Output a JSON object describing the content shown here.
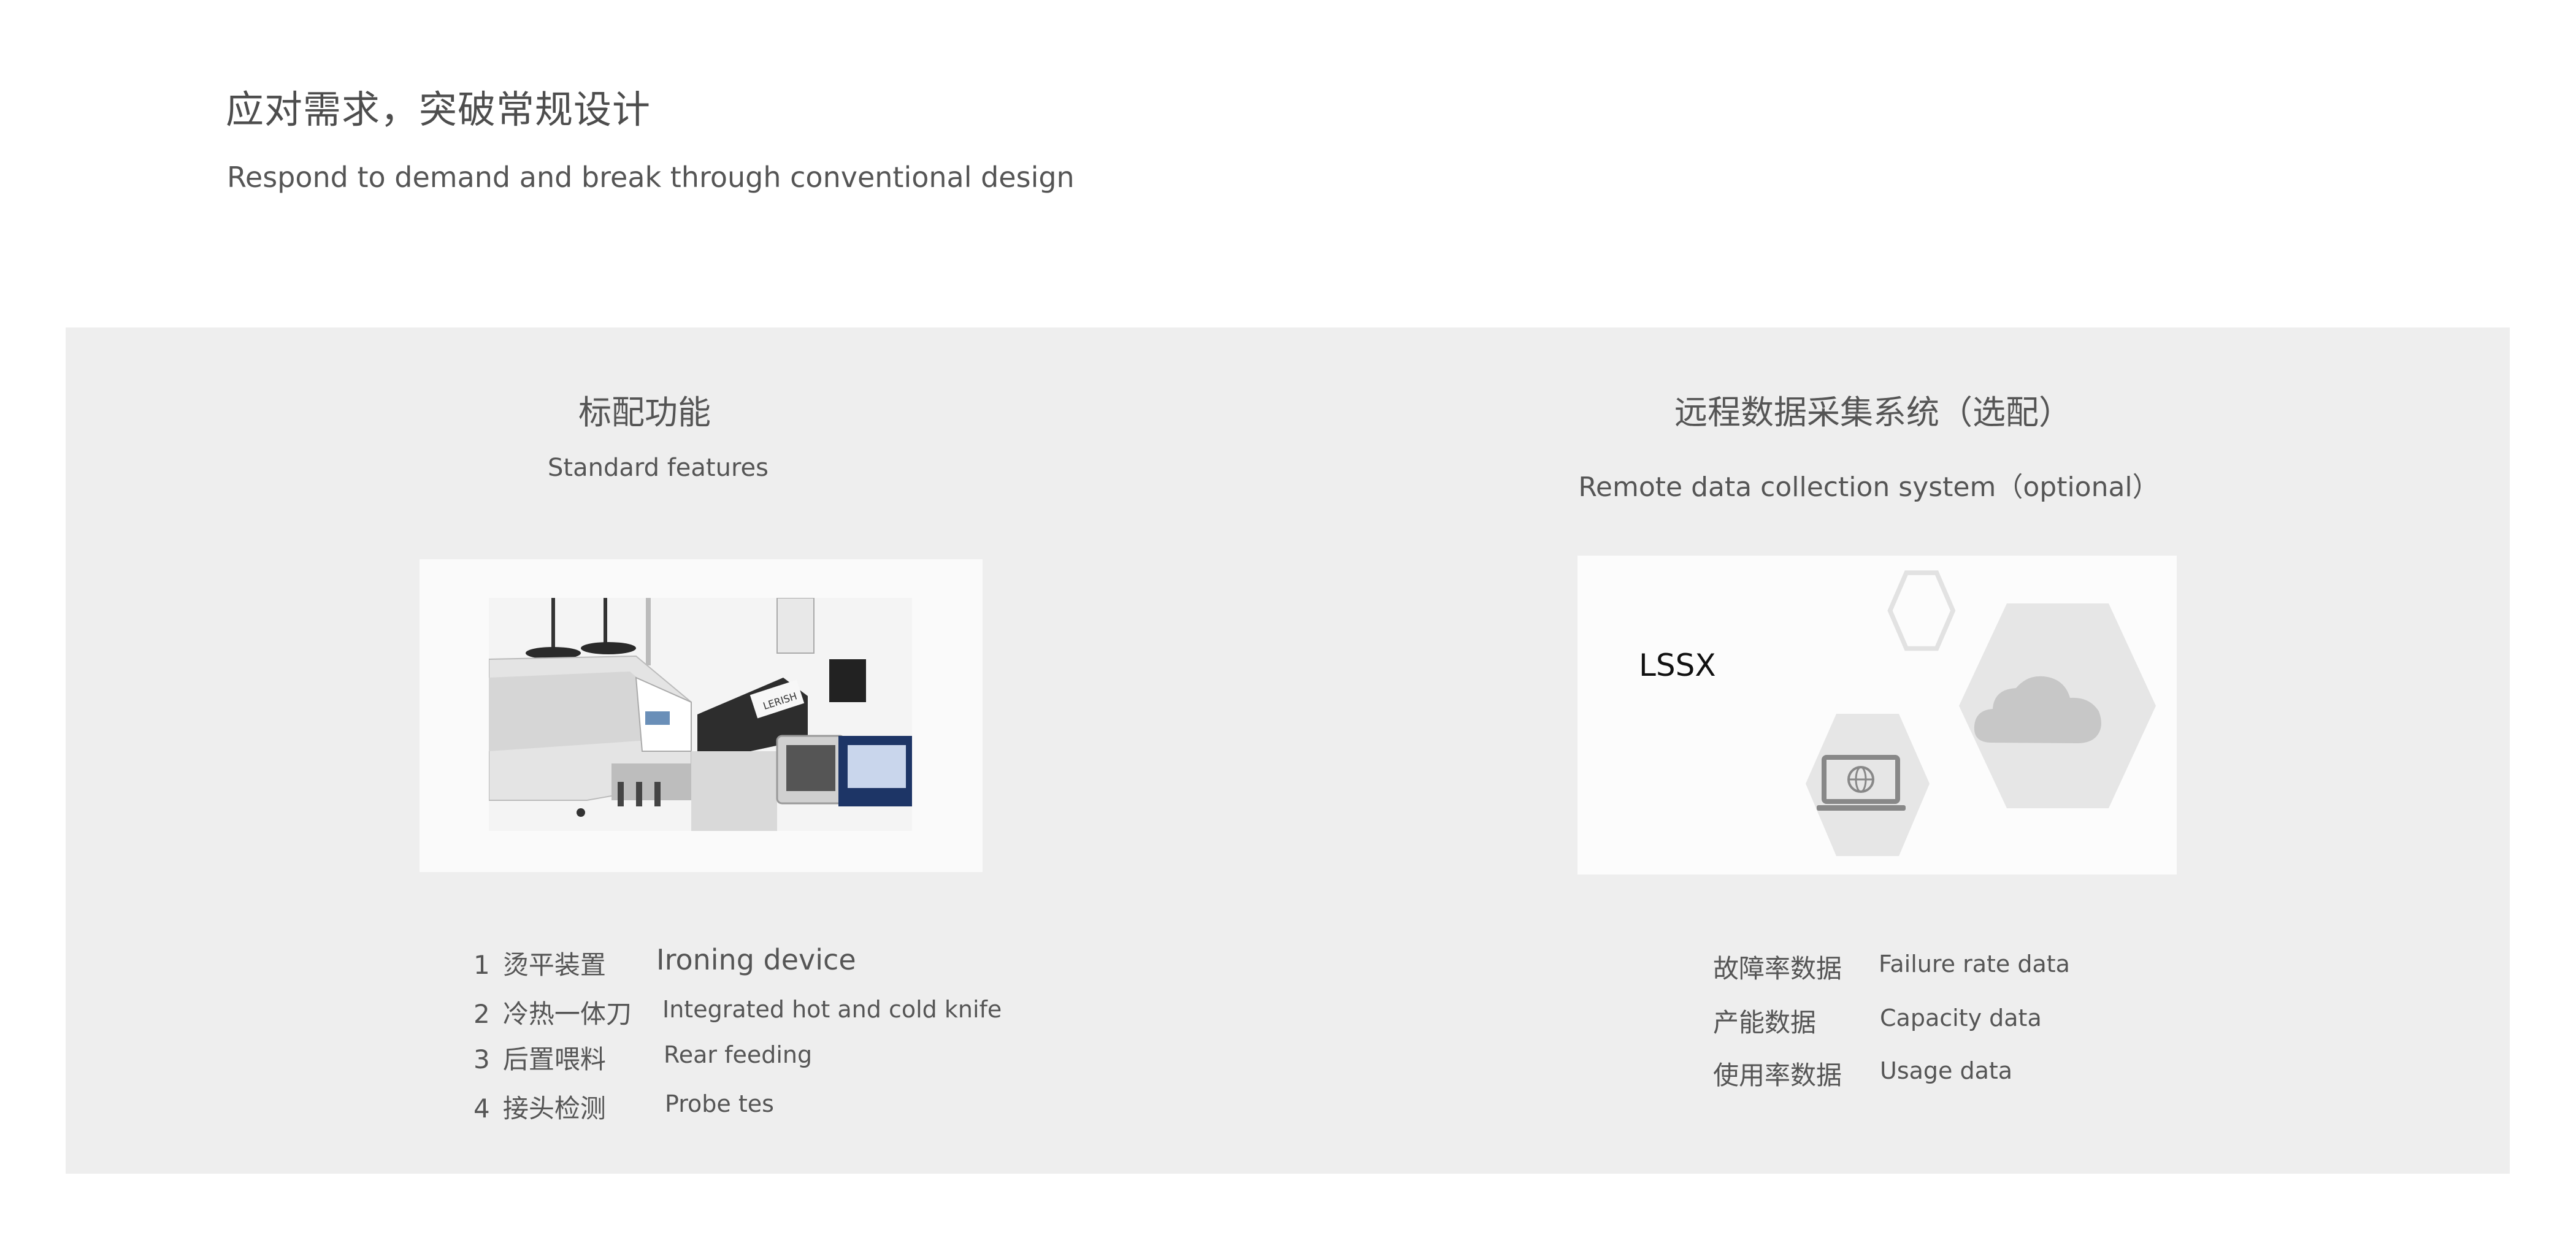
{
  "header": {
    "title": "应对需求，突破常规设计",
    "subtitle": "Respond to demand and break through conventional design"
  },
  "standard": {
    "title": "标配功能",
    "subtitle": "Standard features",
    "image_brand": "LERISH",
    "features": [
      {
        "num": "1",
        "cn": "烫平装置",
        "en": "Ironing device"
      },
      {
        "num": "2",
        "cn": "冷热一体刀",
        "en": "Integrated hot and cold knife"
      },
      {
        "num": "3",
        "cn": "后置喂料",
        "en": "Rear feeding"
      },
      {
        "num": "4",
        "cn": "接头检测",
        "en": "Probe tes"
      }
    ]
  },
  "remote": {
    "title": "远程数据采集系统（选配）",
    "subtitle": "Remote data collection system（optional）",
    "card_label": "LSSX",
    "data_items": [
      {
        "cn": "故障率数据",
        "en": "Failure rate data"
      },
      {
        "cn": "产能数据",
        "en": "Capacity  data"
      },
      {
        "cn": "使用率数据",
        "en": "Usage  data"
      }
    ]
  },
  "colors": {
    "panel_bg": "#eeeeee",
    "hex_fill": "#e6e6e6",
    "text": "#555555"
  }
}
